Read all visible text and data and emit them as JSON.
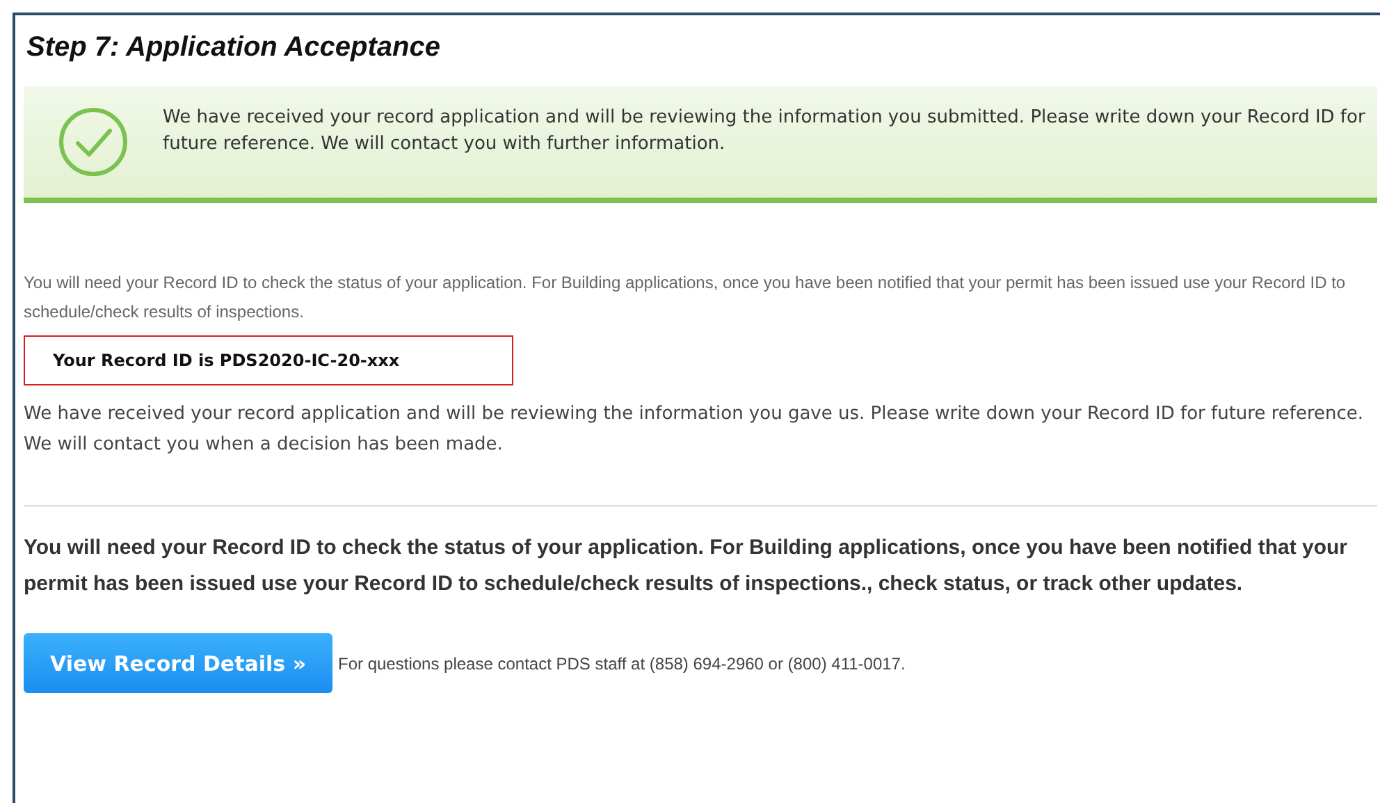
{
  "title": "Step 7: Application Acceptance",
  "notice": {
    "kind": "success",
    "text": "We have received your record application and will be reviewing the information you submitted. Please write down your Record ID for future reference. We will contact you with further information."
  },
  "status_info": "You will need your Record ID to check the status of your application. For Building applications, once you have been notified that your permit has been issued use your Record ID to schedule/check results of inspections.",
  "record_id": "Your Record ID is PDS2020-IC-20-xxx",
  "received_message": "We have received your record application and will be reviewing the information you gave us. Please write down your Record ID for future reference. We will contact you when a decision has been made.",
  "instructions": "You will need your Record ID to check the status of your application. For Building applications, once you have been notified that your permit has been issued use your Record ID to schedule/check results of inspections., check status, or track other updates.",
  "button": "View Record Details »",
  "contact": "For questions please contact PDS staff at (858) 694-2960 or (800) 411-0017."
}
